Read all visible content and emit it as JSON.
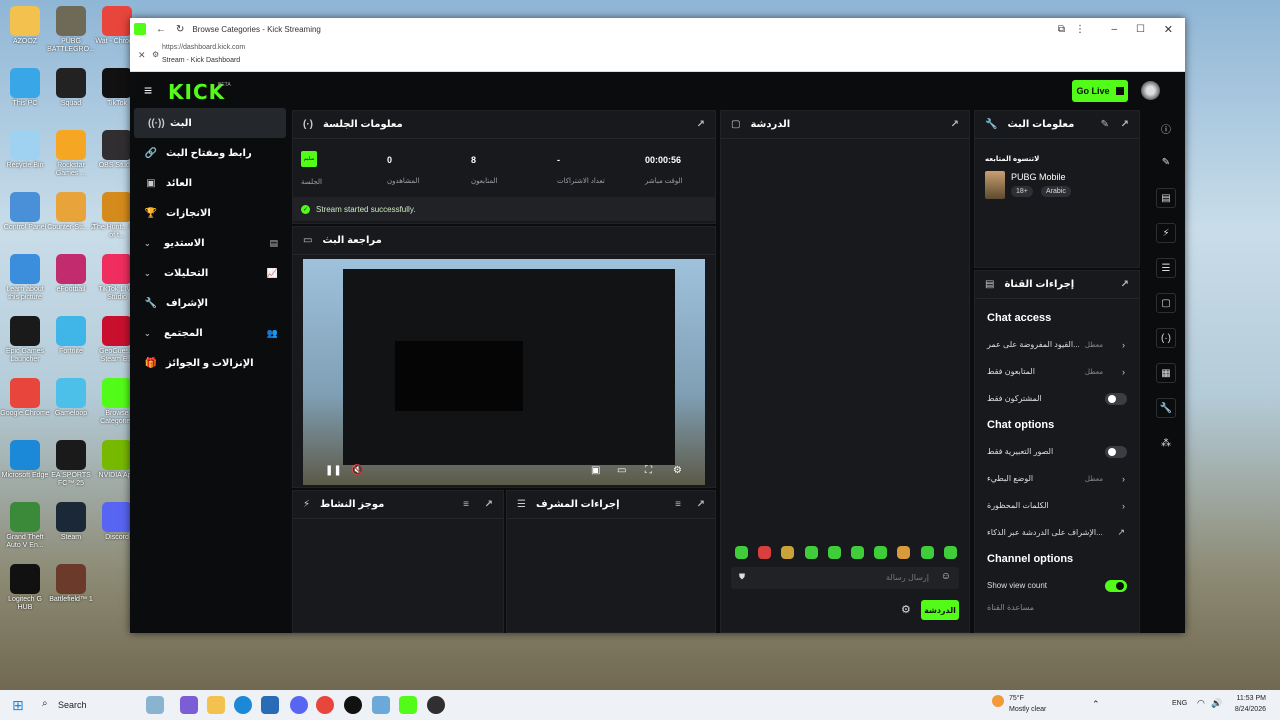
{
  "desktop": {
    "icons": [
      {
        "label": "AZOOZ",
        "color": "#f2c14e"
      },
      {
        "label": "PUBG BATTLEGRO...",
        "color": "#6f6a58"
      },
      {
        "label": "Wat - Chrome",
        "color": "#e8453c"
      },
      {
        "label": "This PC",
        "color": "#39a6e8"
      },
      {
        "label": "Squad",
        "color": "#222222"
      },
      {
        "label": "TikTok",
        "color": "#111111"
      },
      {
        "label": "Recycle Bin",
        "color": "#9fd2f0"
      },
      {
        "label": "Rockstar Games ...",
        "color": "#f5a623"
      },
      {
        "label": "OBS Studio",
        "color": "#302e31"
      },
      {
        "label": "Control Panel",
        "color": "#4a90d9"
      },
      {
        "label": "Counter-Str... 2",
        "color": "#e8a33a"
      },
      {
        "label": "The Hunt... Call of t...",
        "color": "#d58b1c"
      },
      {
        "label": "Learn about this picture",
        "color": "#3b8edb"
      },
      {
        "label": "eFootball",
        "color": "#c22c6e"
      },
      {
        "label": "TikTok LIVE Studio",
        "color": "#ef2d5e"
      },
      {
        "label": "Epic Games Launcher",
        "color": "#1a1a1a"
      },
      {
        "label": "Fortnite",
        "color": "#3fb5e8"
      },
      {
        "label": "GeoGuessr Steam E...",
        "color": "#c8102e"
      },
      {
        "label": "Google Chrome",
        "color": "#e8453c"
      },
      {
        "label": "Gameloop",
        "color": "#4cc0e8"
      },
      {
        "label": "Browse Categories",
        "color": "#53fc18"
      },
      {
        "label": "Microsoft Edge",
        "color": "#1b88d8"
      },
      {
        "label": "EA SPORTS FC™ 25",
        "color": "#1a1a1a"
      },
      {
        "label": "NVIDIA App",
        "color": "#76b900"
      },
      {
        "label": "Grand Theft Auto V En...",
        "color": "#3a8a3a"
      },
      {
        "label": "Steam",
        "color": "#1b2838"
      },
      {
        "label": "Discord",
        "color": "#5865f2"
      },
      {
        "label": "Logitech G HUB",
        "color": "#111111"
      },
      {
        "label": "Battlefield™ 1",
        "color": "#6b3a2a"
      }
    ]
  },
  "browser": {
    "tab_title": "Browse Categories - Kick Streaming",
    "popup_url": "https://dashboard.kick.com",
    "popup_title": "Stream - Kick Dashboard"
  },
  "app": {
    "logo": "KICK",
    "logo_badge": "BETA",
    "go_live": "Go Live",
    "sidebar": [
      {
        "label": "البث",
        "icon": "broadcast-icon"
      },
      {
        "label": "رابط ومفتاح البث",
        "icon": "link-icon"
      },
      {
        "label": "العائد",
        "icon": "wallet-icon"
      },
      {
        "label": "الانجازات",
        "icon": "trophy-icon"
      },
      {
        "label": "الاستديو",
        "icon": "studio-icon"
      },
      {
        "label": "التحليلات",
        "icon": "analytics-icon"
      },
      {
        "label": "الإشراف",
        "icon": "wrench-icon"
      },
      {
        "label": "المجتمع",
        "icon": "community-icon"
      },
      {
        "label": "الإنزالات و الجوائز",
        "icon": "drops-icon"
      }
    ],
    "session": {
      "title": "معلومات الجلسة",
      "badge": "سليم",
      "health_label": "الجلسة",
      "viewers": "0",
      "viewers_label": "المشاهدون",
      "followers": "8",
      "followers_label": "المتابعون",
      "subs": "-",
      "subs_label": "تعداد الاشتراكات",
      "uptime": "00:00:56",
      "uptime_label": "الوقت مباشر",
      "status": "Stream started successfully."
    },
    "preview_title": "مراجعة البث",
    "activity_title": "موجز النشاط",
    "mod_actions_title": "إجراءات المشرف",
    "chat": {
      "title": "الدردشة",
      "placeholder": "إرسال رسالة",
      "send": "الدردشة"
    },
    "stream_info": {
      "title": "معلومات البث",
      "category_label": "لاتنسوه المتابعه",
      "game": "PUBG Mobile",
      "tags": [
        "18+",
        "Arabic"
      ]
    },
    "channel_actions": {
      "title": "إجراءات القناة",
      "chat_access": "Chat access",
      "chat_options": "Chat options",
      "channel_options": "Channel options",
      "rows": {
        "account_age": "القيود المفروضة على عمر...",
        "account_age_state": "معطل",
        "followers_only": "المتابعون فقط",
        "followers_only_state": "معطل",
        "subs_only": "المشتركون فقط",
        "emotes_only": "الصور التعبيرية فقط",
        "slow_mode": "الوضع البطيء",
        "slow_mode_state": "معطل",
        "banned_words": "الكلمات المحظورة",
        "ai_moderation": "الإشراف على الدردشة عبر الذكاء...",
        "show_view_count": "Show view count",
        "channel_note": "مساعدة القناة"
      }
    }
  },
  "taskbar": {
    "search": "Search",
    "weather_temp": "75°F",
    "weather_desc": "Mostly clear",
    "lang": "ENG",
    "time": "11:53 PM",
    "date": "8/24/2026"
  },
  "colors": {
    "accent": "#53fc18",
    "panel": "#18191c",
    "bg": "#0b0c0d"
  }
}
